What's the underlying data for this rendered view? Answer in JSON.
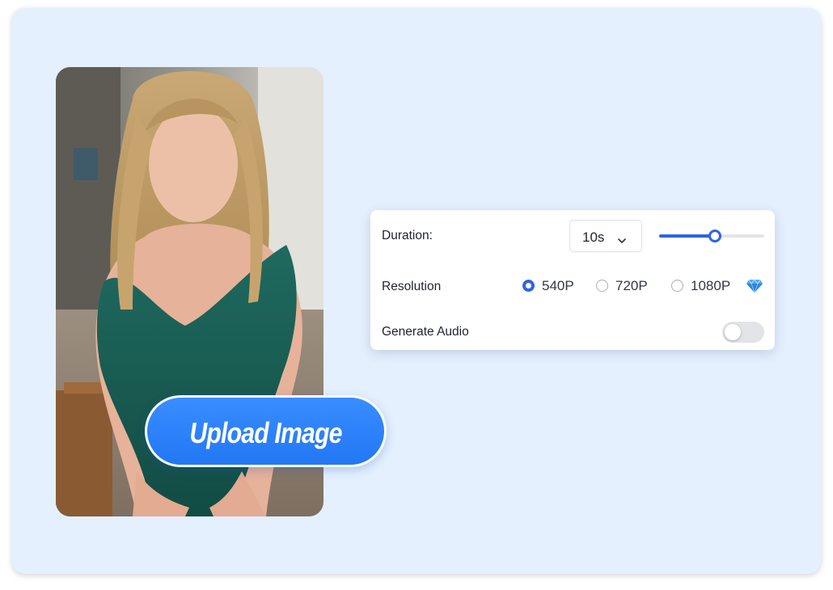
{
  "settings": {
    "duration_label": "Duration:",
    "duration_value": "10s",
    "duration_slider_fraction": 0.53,
    "resolution_label": "Resolution",
    "resolution_options": [
      {
        "label": "540P",
        "selected": true
      },
      {
        "label": "720P",
        "selected": false
      },
      {
        "label": "1080P",
        "selected": false
      }
    ],
    "premium_icon": "diamond-icon",
    "audio_label": "Generate Audio",
    "audio_enabled": false
  },
  "upload": {
    "button_label": "Upload Image"
  },
  "colors": {
    "background": "#e4f0fe",
    "accent": "#2e63e5",
    "button": "#2a80fb"
  }
}
